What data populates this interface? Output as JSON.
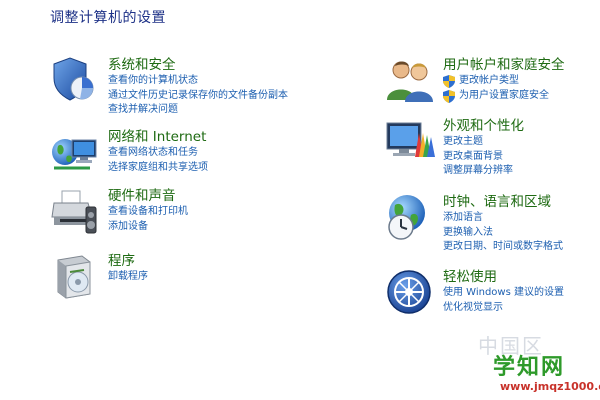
{
  "page_title": "调整计算机的设置",
  "left": [
    {
      "heading": "系统和安全",
      "links": [
        "查看你的计算机状态",
        "通过文件历史记录保存你的文件备份副本",
        "查找并解决问题"
      ]
    },
    {
      "heading": "网络和 Internet",
      "links": [
        "查看网络状态和任务",
        "选择家庭组和共享选项"
      ]
    },
    {
      "heading": "硬件和声音",
      "links": [
        "查看设备和打印机",
        "添加设备"
      ]
    },
    {
      "heading": "程序",
      "links": [
        "卸载程序"
      ]
    }
  ],
  "right": [
    {
      "heading": "用户帐户和家庭安全",
      "links": [
        "更改帐户类型",
        "为用户设置家庭安全"
      ]
    },
    {
      "heading": "外观和个性化",
      "links": [
        "更改主题",
        "更改桌面背景",
        "调整屏幕分辨率"
      ]
    },
    {
      "heading": "时钟、语言和区域",
      "links": [
        "添加语言",
        "更换输入法",
        "更改日期、时间或数字格式"
      ]
    },
    {
      "heading": "轻松使用",
      "links": [
        "使用 Windows 建议的设置",
        "优化视觉显示"
      ]
    }
  ],
  "icons": {
    "system_security": "shield-chart-icon",
    "network": "globe-network-icon",
    "hardware": "printer-speaker-icon",
    "programs": "software-box-icon",
    "user_accounts": "users-icon",
    "appearance": "monitor-paint-icon",
    "clock": "globe-clock-icon",
    "ease_of_access": "ease-of-access-icon",
    "uac": "uac-shield-icon"
  },
  "watermark": {
    "faint": "中国区",
    "brand": "学知网",
    "url": "www.jmqz1000.com"
  },
  "colors": {
    "heading": "#1e6a12",
    "link": "#1d5fb0",
    "title": "#1e3287",
    "watermark_green": "#2e9a2a",
    "watermark_red": "#c8322a"
  }
}
